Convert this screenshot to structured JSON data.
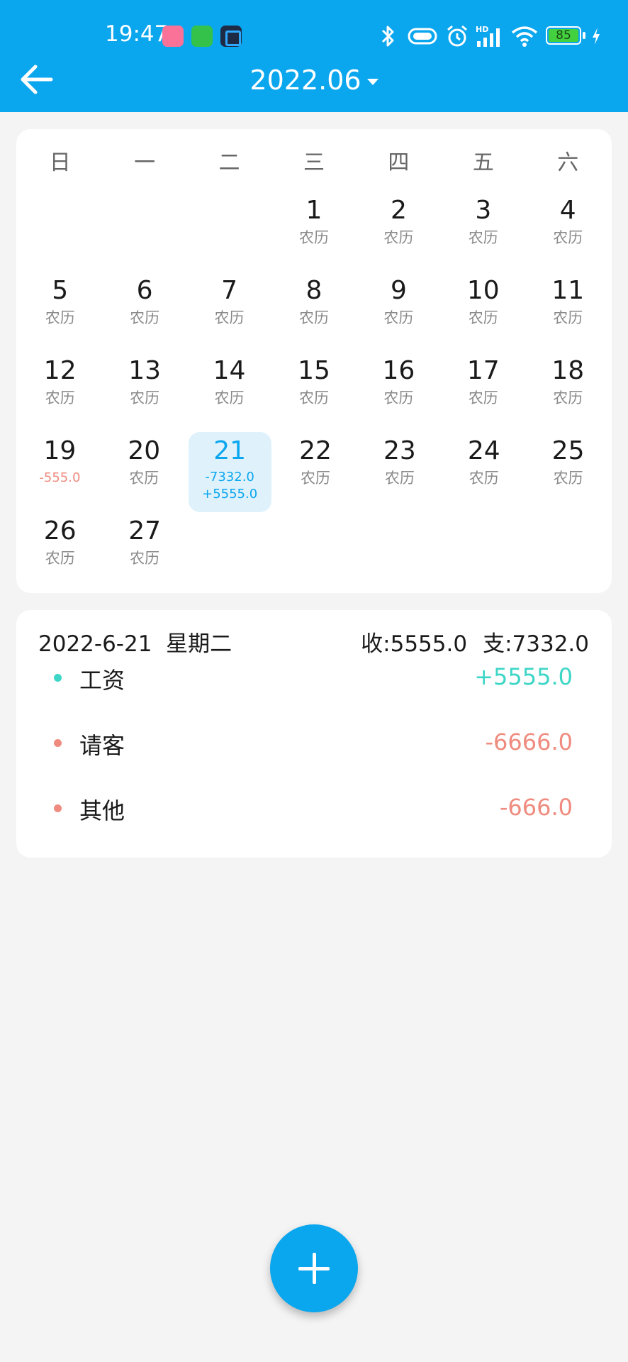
{
  "status_bar": {
    "time": "19:47",
    "battery_level": "85",
    "icons": [
      "bilibili-app-icon",
      "green-app-icon",
      "dark-app-icon",
      "bluetooth-icon",
      "nfc-icon",
      "alarm-icon",
      "hd-signal-icon",
      "wifi-icon",
      "battery-icon",
      "charging-icon"
    ]
  },
  "header": {
    "month": "2022.06",
    "back_icon": "arrow-left-icon"
  },
  "calendar": {
    "weekdays": [
      "日",
      "一",
      "二",
      "三",
      "四",
      "五",
      "六"
    ],
    "weeks": [
      [
        {
          "num": "",
          "sub": ""
        },
        {
          "num": "",
          "sub": ""
        },
        {
          "num": "",
          "sub": ""
        },
        {
          "num": "1",
          "sub": "农历"
        },
        {
          "num": "2",
          "sub": "农历"
        },
        {
          "num": "3",
          "sub": "农历"
        },
        {
          "num": "4",
          "sub": "农历"
        }
      ],
      [
        {
          "num": "5",
          "sub": "农历"
        },
        {
          "num": "6",
          "sub": "农历"
        },
        {
          "num": "7",
          "sub": "农历"
        },
        {
          "num": "8",
          "sub": "农历"
        },
        {
          "num": "9",
          "sub": "农历"
        },
        {
          "num": "10",
          "sub": "农历"
        },
        {
          "num": "11",
          "sub": "农历"
        }
      ],
      [
        {
          "num": "12",
          "sub": "农历"
        },
        {
          "num": "13",
          "sub": "农历"
        },
        {
          "num": "14",
          "sub": "农历"
        },
        {
          "num": "15",
          "sub": "农历"
        },
        {
          "num": "16",
          "sub": "农历"
        },
        {
          "num": "17",
          "sub": "农历"
        },
        {
          "num": "18",
          "sub": "农历"
        }
      ],
      [
        {
          "num": "19",
          "expense": "-555.0"
        },
        {
          "num": "20",
          "sub": "农历"
        },
        {
          "num": "21",
          "expense": "-7332.0",
          "income": "+5555.0",
          "selected": true
        },
        {
          "num": "22",
          "sub": "农历"
        },
        {
          "num": "23",
          "sub": "农历"
        },
        {
          "num": "24",
          "sub": "农历"
        },
        {
          "num": "25",
          "sub": "农历"
        }
      ],
      [
        {
          "num": "26",
          "sub": "农历"
        },
        {
          "num": "27",
          "sub": "农历"
        },
        {
          "num": "",
          "sub": ""
        },
        {
          "num": "",
          "sub": ""
        },
        {
          "num": "",
          "sub": ""
        },
        {
          "num": "",
          "sub": ""
        },
        {
          "num": "",
          "sub": ""
        }
      ]
    ]
  },
  "detail": {
    "date": "2022-6-21",
    "weekday": "星期二",
    "income_total": "收:5555.0",
    "expense_total": "支:7332.0",
    "records": [
      {
        "name": "工资",
        "amount": "+5555.0",
        "type": "income"
      },
      {
        "name": "请客",
        "amount": "-6666.0",
        "type": "expense"
      },
      {
        "name": "其他",
        "amount": "-666.0",
        "type": "expense"
      }
    ]
  },
  "fab": {
    "icon": "plus-icon"
  },
  "colors": {
    "primary": "#0aa6ee",
    "income": "#3dd6c6",
    "expense": "#ef8b7f",
    "selected_bg": "#dff2fc",
    "background": "#f4f4f4"
  }
}
